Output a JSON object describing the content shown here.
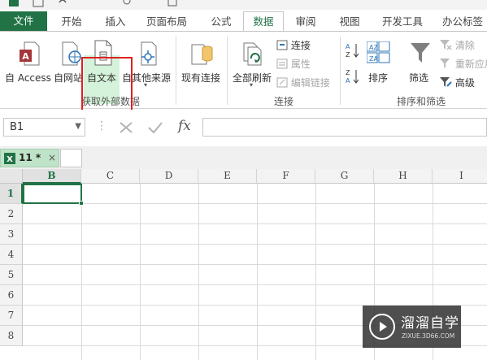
{
  "ribbon_tabs": {
    "file": "文件",
    "home": "开始",
    "insert": "插入",
    "page_layout": "页面布局",
    "formulas": "公式",
    "data": "数据",
    "review": "审阅",
    "view": "视图",
    "developer": "开发工具",
    "office_tabs": "办公标签"
  },
  "get_external_data": {
    "from_access": "自 Access",
    "from_web": "自网站",
    "from_text": "自文本",
    "from_other_sources": "自其他来源",
    "group_label": "获取外部数据"
  },
  "existing_connections": "现有连接",
  "connections": {
    "refresh_all": "全部刷新",
    "connections": "连接",
    "properties": "属性",
    "edit_links": "编辑链接",
    "group_label": "连接"
  },
  "sort_filter": {
    "sort": "排序",
    "filter": "筛选",
    "clear": "清除",
    "reapply": "重新应用",
    "advanced": "高级",
    "group_label": "排序和筛选",
    "sort_asc_label": "AZ",
    "sort_desc_label": "ZA"
  },
  "formula_bar": {
    "name_box": "B1",
    "fx_label": "fx",
    "formula_value": ""
  },
  "sheet_tab": {
    "name": "11 *",
    "close": "×"
  },
  "grid": {
    "columns": [
      "B",
      "C",
      "D",
      "E",
      "F",
      "G",
      "H",
      "I"
    ],
    "rows": [
      "1",
      "2",
      "3",
      "4",
      "5",
      "6",
      "7",
      "8"
    ],
    "selected_column": "B",
    "selected_row": "1"
  },
  "watermark": {
    "title": "溜溜自学",
    "subtitle": "ZIXUE.3D66.COM"
  },
  "colors": {
    "excel_green": "#217346",
    "highlight_red": "#e02020",
    "selected_button": "#c6efce"
  }
}
